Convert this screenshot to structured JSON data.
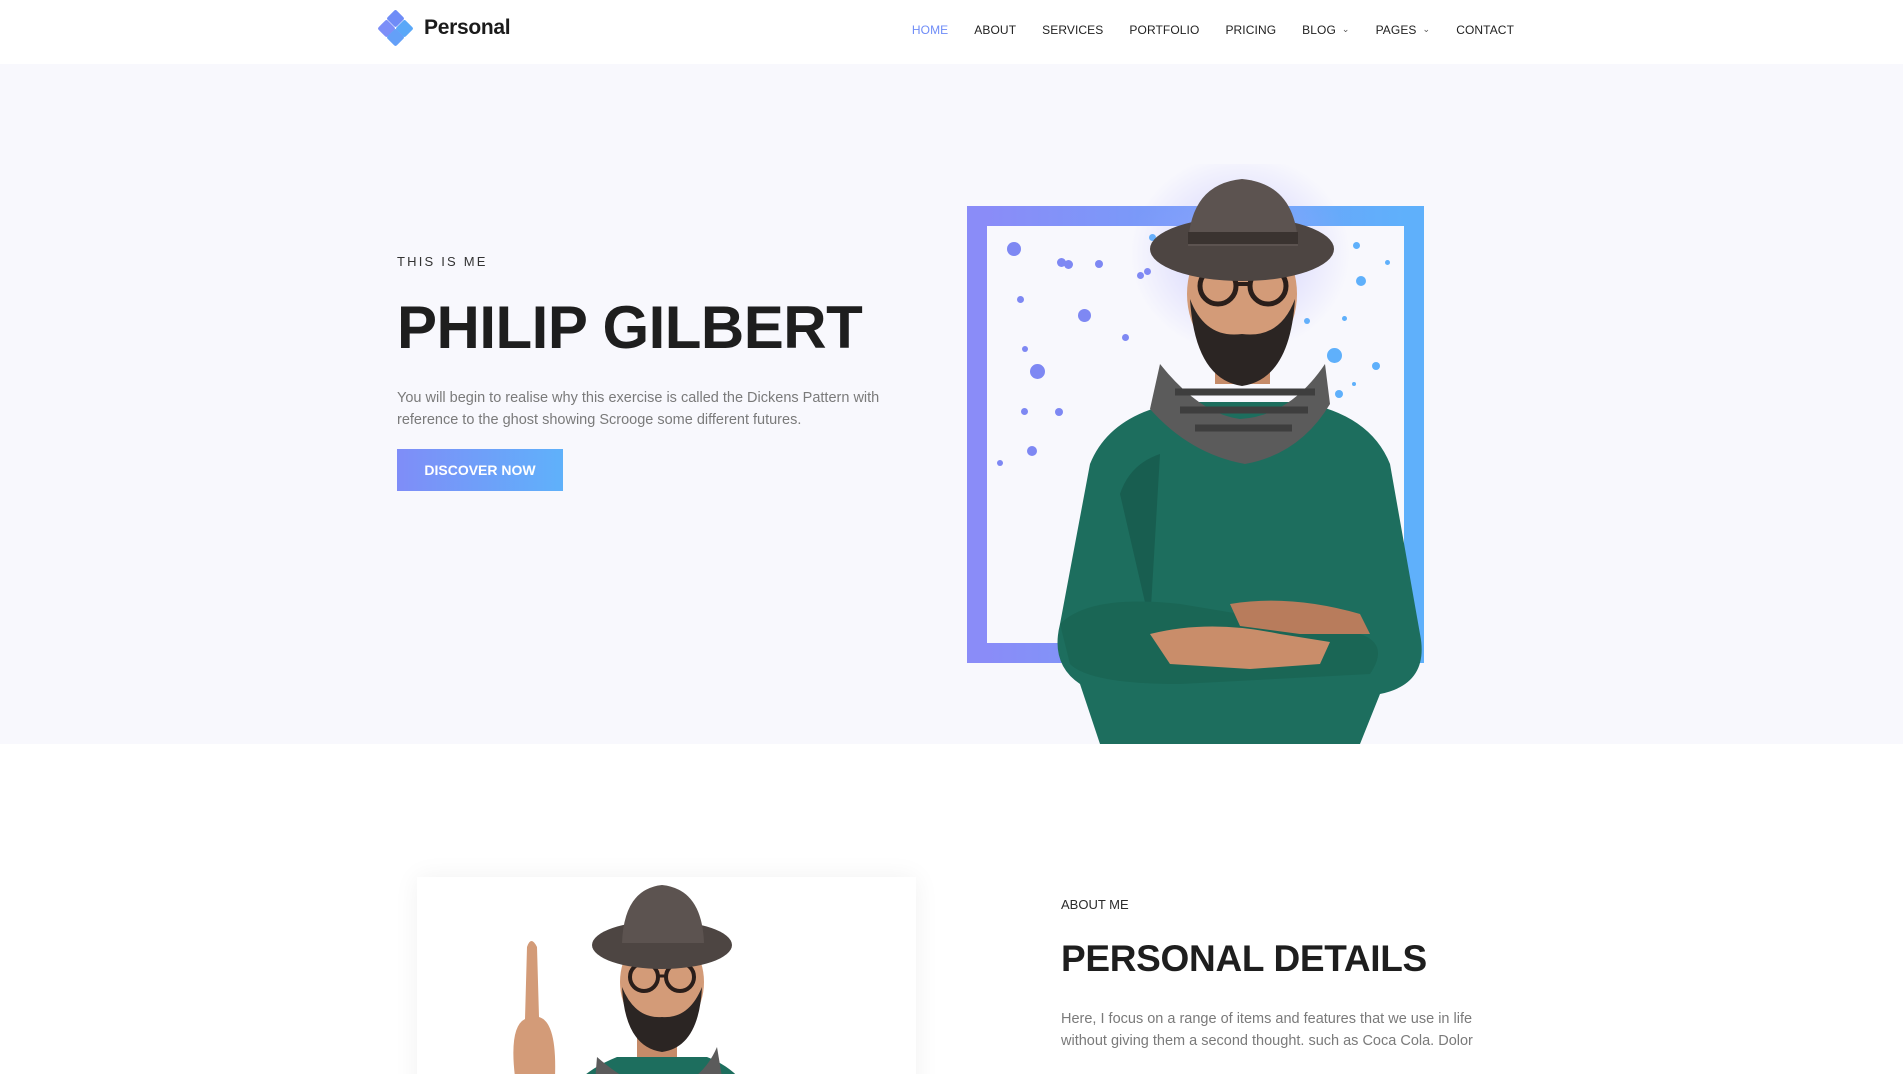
{
  "brand": {
    "name": "Personal",
    "icon": "diamond-cluster-logo-icon"
  },
  "nav": {
    "items": [
      {
        "label": "HOME",
        "active": true
      },
      {
        "label": "ABOUT"
      },
      {
        "label": "SERVICES"
      },
      {
        "label": "PORTFOLIO"
      },
      {
        "label": "PRICING"
      },
      {
        "label": "BLOG",
        "dropdown": true
      },
      {
        "label": "PAGES",
        "dropdown": true
      },
      {
        "label": "CONTACT"
      }
    ],
    "active_color": "#6f8cf7"
  },
  "hero": {
    "eyebrow": "THIS IS ME",
    "title": "PHILIP GILBERT",
    "description": "You will begin to realise why this exercise is called the Dickens Pattern with reference to the ghost showing Scrooge some different futures.",
    "cta_label": "DISCOVER NOW",
    "accent_gradient": [
      "#7f8df8",
      "#5fb1fa"
    ]
  },
  "about": {
    "eyebrow": "ABOUT ME",
    "title": "PERSONAL DETAILS",
    "description": "Here, I focus on a range of items and features that we use in life without giving them a second thought. such as Coca Cola. Dolor"
  }
}
